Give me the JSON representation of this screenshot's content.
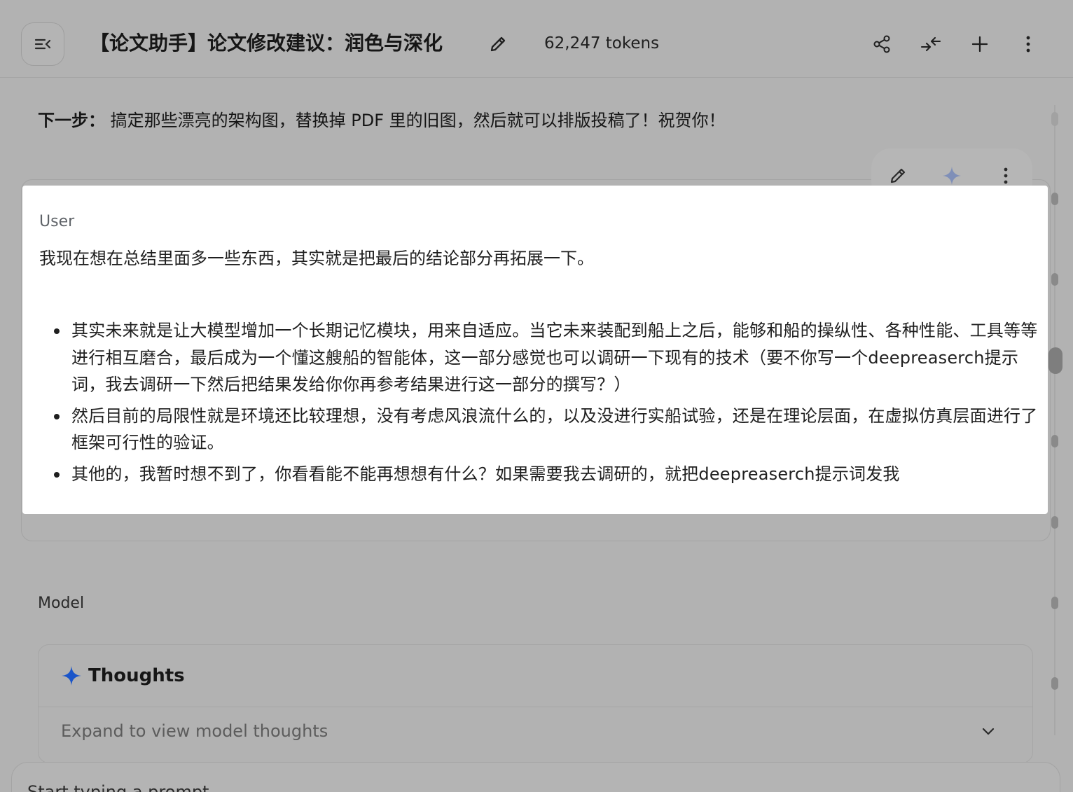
{
  "header": {
    "title": "【论文助手】论文修改建议：润色与深化",
    "tokens": "62,247 tokens"
  },
  "conversation": {
    "next_step_label": "下一步：",
    "next_step_text": " 搞定那些漂亮的架构图，替换掉 PDF 里的旧图，然后就可以排版投稿了！祝贺你！",
    "user_turn": {
      "role": "User",
      "paragraph": "我现在想在总结里面多一些东西，其实就是把最后的结论部分再拓展一下。",
      "bullets": [
        "其实未来就是让大模型增加一个长期记忆模块，用来自适应。当它未来装配到船上之后，能够和船的操纵性、各种性能、工具等等进行相互磨合，最后成为一个懂这艘船的智能体，这一部分感觉也可以调研一下现有的技术（要不你写一个deepreaserch提示词，我去调研一下然后把结果发给你你再参考结果进行这一部分的撰写？）",
        "然后目前的局限性就是环境还比较理想，没有考虑风浪流什么的，以及没进行实船试验，还是在理论层面，在虚拟仿真层面进行了框架可行性的验证。",
        "其他的，我暂时想不到了，你看看能不能再想想有什么？如果需要我去调研的，就把deepreaserch提示词发我"
      ]
    },
    "model_turn": {
      "role": "Model",
      "thoughts_title": "Thoughts",
      "thoughts_expand": "Expand to view model thoughts"
    }
  },
  "prompt": {
    "placeholder": "Start typing a prompt"
  },
  "colors": {
    "overlay": "#b2b2b2",
    "card": "#ffffff",
    "spark_blue": "#1a55c9",
    "spark_muted": "#7f8fb8"
  },
  "icons": [
    "menu-collapse-icon",
    "pencil-icon",
    "share-icon",
    "compare-icon",
    "plus-icon",
    "more-vert-icon",
    "sparkle-icon",
    "chevron-down-icon"
  ]
}
